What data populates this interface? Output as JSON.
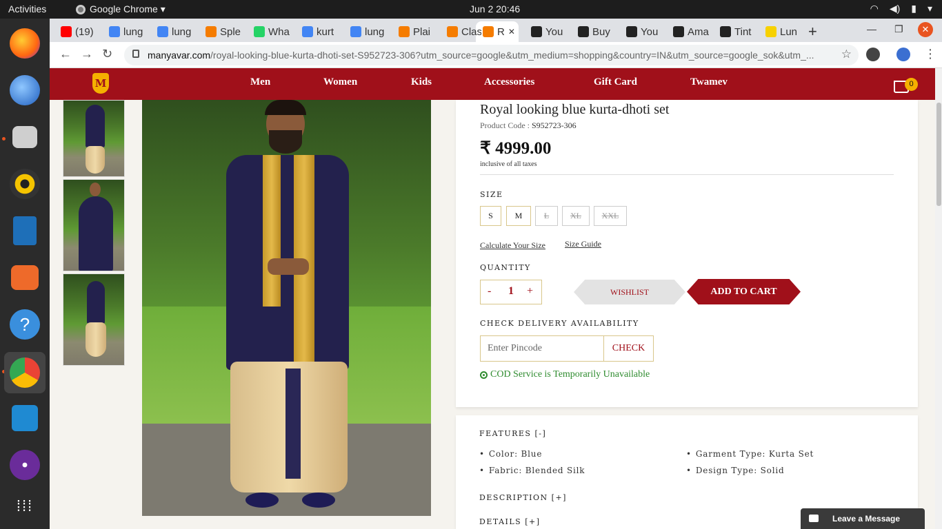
{
  "topbar": {
    "activities": "Activities",
    "app_name": "Google Chrome ▾",
    "clock": "Jun 2  20:46"
  },
  "tabs": [
    {
      "label": "(19)",
      "icon": "youtube-icon",
      "color": "#ff0000"
    },
    {
      "label": "lung",
      "icon": "google-icon",
      "color": "#4285f4"
    },
    {
      "label": "lung",
      "icon": "google-icon",
      "color": "#4285f4"
    },
    {
      "label": "Sple",
      "icon": "manyavar-icon",
      "color": "#f57c00"
    },
    {
      "label": "Wha",
      "icon": "whatsapp-icon",
      "color": "#25d366"
    },
    {
      "label": "kurt",
      "icon": "google-icon",
      "color": "#4285f4"
    },
    {
      "label": "lung",
      "icon": "google-icon",
      "color": "#4285f4"
    },
    {
      "label": "Plai",
      "icon": "manyavar-icon",
      "color": "#f57c00"
    },
    {
      "label": "Clas",
      "icon": "manyavar-icon",
      "color": "#f57c00"
    },
    {
      "label": "R",
      "icon": "manyavar-icon",
      "color": "#f57c00",
      "active": true
    },
    {
      "label": "You",
      "icon": "amazon-icon",
      "color": "#222222"
    },
    {
      "label": "Buy",
      "icon": "amazon-icon",
      "color": "#222222"
    },
    {
      "label": "You",
      "icon": "amazon-icon",
      "color": "#222222"
    },
    {
      "label": "Ama",
      "icon": "amazon-icon",
      "color": "#222222"
    },
    {
      "label": "Tint",
      "icon": "amazon-icon",
      "color": "#222222"
    },
    {
      "label": "Lun",
      "icon": "flipkart-icon",
      "color": "#f7d100"
    }
  ],
  "omnibox": {
    "url_host": "manyavar.com",
    "url_path": "/royal-looking-blue-kurta-dhoti-set-S952723-306?utm_source=google&utm_medium=shopping&country=IN&utm_source=google_sok&utm_..."
  },
  "site_nav": {
    "logo": "M",
    "links": [
      "Men",
      "Women",
      "Kids",
      "Accessories",
      "Gift Card",
      "Twamev"
    ],
    "cart_count": "0"
  },
  "product": {
    "title": "Royal looking blue kurta-dhoti set",
    "code_label": "Product Code : ",
    "code_value": "S952723-306",
    "price": "₹ 4999.00",
    "tax_note": "inclusive of all taxes",
    "size_label": "SIZE",
    "sizes": [
      {
        "label": "S",
        "available": true
      },
      {
        "label": "M",
        "available": true
      },
      {
        "label": "L",
        "available": false
      },
      {
        "label": "XL",
        "available": false
      },
      {
        "label": "XXL",
        "available": false
      }
    ],
    "calc_size_link": "Calculate Your Size",
    "size_guide_link": "Size Guide",
    "quantity_label": "QUANTITY",
    "qty_minus": "-",
    "qty_value": "1",
    "qty_plus": "+",
    "wishlist": "WISHLIST",
    "add_to_cart": "ADD TO CART",
    "delivery_label": "CHECK DELIVERY AVAILABILITY",
    "pincode_placeholder": "Enter Pincode",
    "check": "CHECK",
    "cod_status": "COD Service is Temporarily Unavailable"
  },
  "details": {
    "features_heading": "FEATURES [-]",
    "features": [
      "Color: Blue",
      "Fabric: Blended Silk",
      "Garment Type: Kurta Set",
      "Design Type: Solid"
    ],
    "description_heading": "DESCRIPTION [+]",
    "details_heading": "DETAILS [+]"
  },
  "chat": {
    "label": "Leave a Message"
  },
  "colors": {
    "brand": "#a0101a",
    "accent_gold": "#f5b000",
    "cod_green": "#2e8b2e"
  }
}
